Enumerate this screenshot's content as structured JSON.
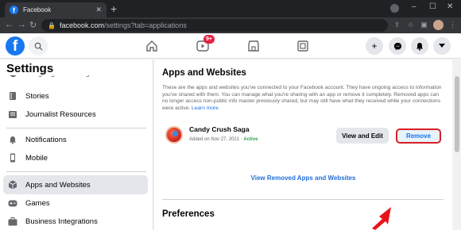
{
  "browser": {
    "tab_title": "Facebook",
    "tab_favicon": "f",
    "url_host": "facebook.com",
    "url_path": "/settings?tab=applications",
    "new_tab": "+",
    "close_tab": "✕"
  },
  "fb_header": {
    "logo": "f",
    "notification_badge": "9+"
  },
  "sidebar": {
    "title": "Settings",
    "items": [
      {
        "label": "Language and Region",
        "icon": "globe-icon"
      },
      {
        "label": "Stories",
        "icon": "book-icon"
      },
      {
        "label": "Journalist Resources",
        "icon": "news-icon"
      },
      {
        "label": "Notifications",
        "icon": "bell-icon"
      },
      {
        "label": "Mobile",
        "icon": "phone-icon"
      },
      {
        "label": "Apps and Websites",
        "icon": "box-icon"
      },
      {
        "label": "Games",
        "icon": "gamepad-icon"
      },
      {
        "label": "Business Integrations",
        "icon": "briefcase-icon"
      }
    ]
  },
  "main": {
    "title": "Apps and Websites",
    "description": "These are the apps and websites you've connected to your Facebook account. They have ongoing access to information you've shared with them. You can manage what you're sharing with an app or remove it completely. Removed apps can no longer access non-public info master previously shared, but may still have what they received while your connections were active.",
    "learn_more": "Learn more",
    "app": {
      "name": "Candy Crush Saga",
      "added": "Added on Nov 27, 2021 · ",
      "status": "Active",
      "view_edit_label": "View and Edit",
      "remove_label": "Remove"
    },
    "view_removed_link": "View Removed Apps and Websites",
    "preferences_title": "Preferences"
  },
  "colors": {
    "brand": "#1877f2",
    "highlight": "#d81f26",
    "link": "#216fdb",
    "active_status": "#31a24c"
  }
}
